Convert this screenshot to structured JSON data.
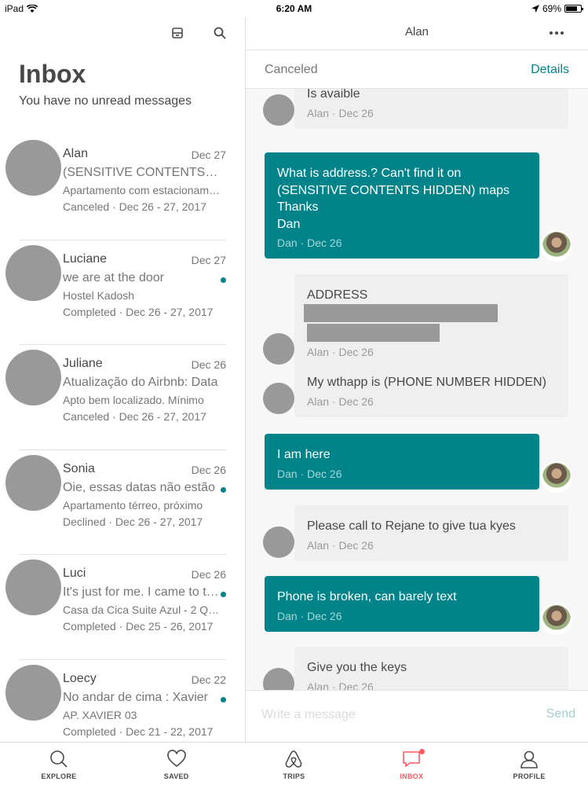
{
  "status_bar": {
    "device": "iPad",
    "time": "6:20 AM",
    "battery": "69%",
    "battery_level": 0.69,
    "icons": [
      "wifi-icon",
      "location-arrow-icon",
      "battery-icon"
    ]
  },
  "inbox": {
    "title": "Inbox",
    "subtitle": "You have no unread messages",
    "icons": [
      "archive-icon",
      "search-icon"
    ],
    "threads": [
      {
        "name": "Alan",
        "date": "Dec 27",
        "preview": "(SENSITIVE CONTENTS HIDDEN)",
        "listing": "Apartamento com estacionamento",
        "status": "Canceled · Dec 26 - 27, 2017",
        "unread": false
      },
      {
        "name": "Luciane",
        "date": "Dec 27",
        "preview": "we are at the door",
        "listing": "Hostel Kadosh",
        "status": "Completed · Dec 26 - 27, 2017",
        "unread": true
      },
      {
        "name": "Juliane",
        "date": "Dec 26",
        "preview": "Atualização do Airbnb: Data",
        "listing": "Apto bem localizado. Mínimo",
        "status": "Canceled · Dec 26 - 27, 2017",
        "unread": false
      },
      {
        "name": "Sonia",
        "date": "Dec 26",
        "preview": "Oie, essas datas não estão",
        "listing": "Apartamento térreo, próximo",
        "status": "Declined · Dec 26 - 27, 2017",
        "unread": true
      },
      {
        "name": "Luci",
        "date": "Dec 26",
        "preview": "It's just for me. I came to the",
        "listing": "Casa da Cica Suite Azul - 2 Quartos",
        "status": "Completed · Dec 25 - 26, 2017",
        "unread": true
      },
      {
        "name": "Loecy",
        "date": "Dec 22",
        "preview": "No andar de cima : Xavier",
        "listing": "AP. XAVIER 03",
        "status": "Completed · Dec 21 - 22, 2017",
        "unread": true
      }
    ]
  },
  "conversation": {
    "title": "Alan",
    "more_icon": "more-horizontal-icon",
    "reservation_status": "Canceled",
    "details_label": "Details",
    "composer_placeholder": "Write a message",
    "send_label": "Send"
  },
  "messages": [
    {
      "dir": "in",
      "lines": [
        "Is avaible"
      ],
      "meta": "Alan · Dec 26"
    },
    {
      "dir": "out",
      "lines": [
        "What is address.? Can't find it on",
        "(SENSITIVE CONTENTS HIDDEN) maps",
        "Thanks",
        "Dan"
      ],
      "meta": "Dan · Dec 26"
    },
    {
      "dir": "in",
      "lines": [
        "ADDRESS"
      ],
      "meta": "Alan · Dec 26"
    },
    {
      "dir": "in",
      "lines": [
        "My wthapp is (PHONE NUMBER HIDDEN)"
      ],
      "meta": "Alan · Dec 26"
    },
    {
      "dir": "out",
      "lines": [
        "I am here"
      ],
      "meta": "Dan · Dec 26"
    },
    {
      "dir": "in",
      "lines": [
        "Please call to Rejane to give tua kyes"
      ],
      "meta": "Alan · Dec 26"
    },
    {
      "dir": "out",
      "lines": [
        "Phone is broken, can barely text"
      ],
      "meta": "Dan · Dec 26"
    },
    {
      "dir": "in",
      "lines": [
        "Give you the keys"
      ],
      "meta": "Alan · Dec 26"
    }
  ],
  "tabs": [
    {
      "label": "EXPLORE",
      "icon": "search-icon",
      "active": false
    },
    {
      "label": "SAVED",
      "icon": "heart-icon",
      "active": false
    },
    {
      "label": "TRIPS",
      "icon": "airbnb-logo-icon",
      "active": false
    },
    {
      "label": "INBOX",
      "icon": "chat-bubble-icon",
      "active": true
    },
    {
      "label": "PROFILE",
      "icon": "person-icon",
      "active": false
    }
  ],
  "colors": {
    "accent": "#008489",
    "active_tab": "#FF5A5F",
    "text": "#484848",
    "muted": "#767676"
  }
}
